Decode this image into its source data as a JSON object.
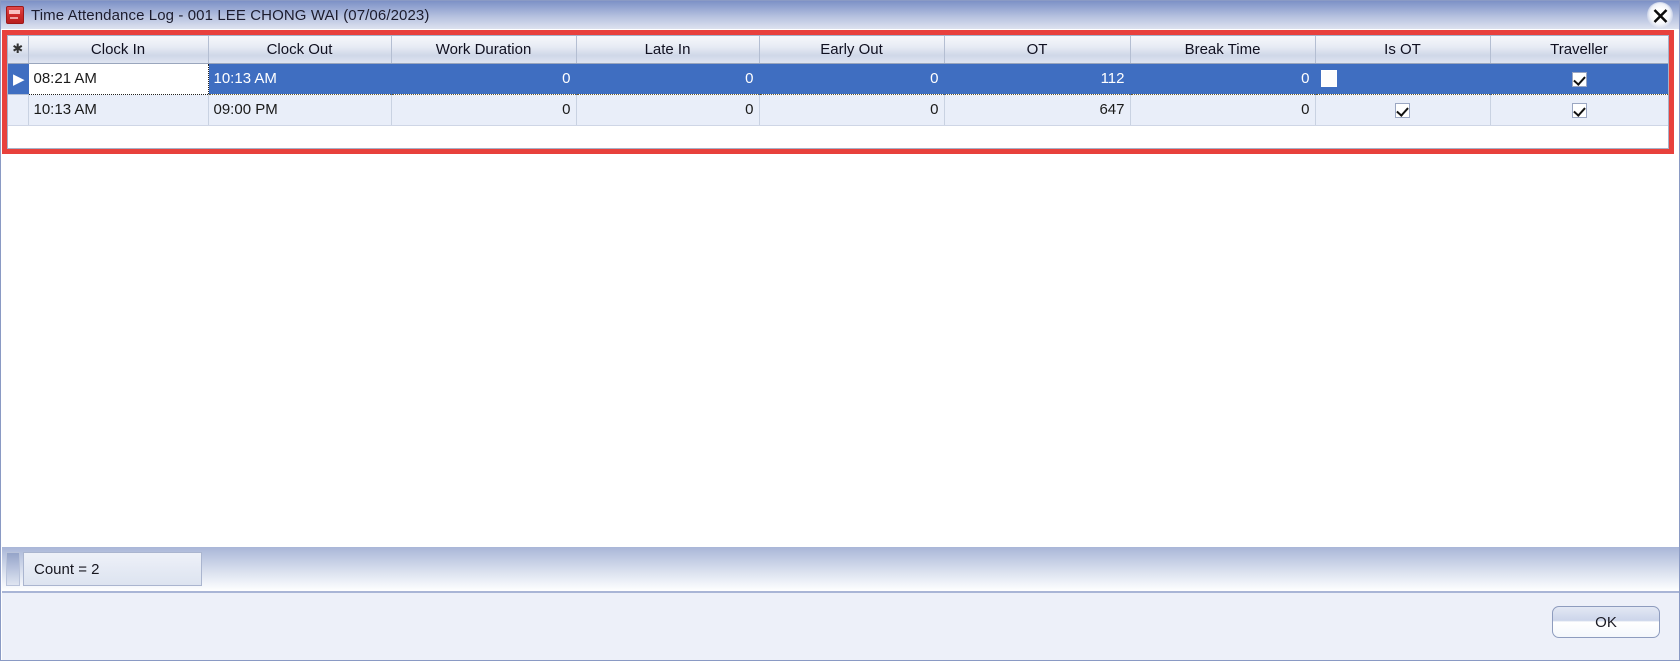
{
  "window": {
    "title": "Time Attendance Log - 001 LEE CHONG WAI (07/06/2023)",
    "icon": "app-logo-icon",
    "close_label": "✕"
  },
  "colors": {
    "title_bar_top": "#7d91c6",
    "title_bar_bottom": "#dde2ef",
    "selection_blue": "#3f6ec1",
    "annotation_red": "#e8413c",
    "row_alt": "#e9eef9"
  },
  "grid": {
    "row_indicator_header": "✱",
    "current_row_marker": "▶",
    "columns": [
      {
        "key": "clock_in",
        "label": "Clock In",
        "align": "left"
      },
      {
        "key": "clock_out",
        "label": "Clock Out",
        "align": "left"
      },
      {
        "key": "work_duration",
        "label": "Work Duration",
        "align": "right"
      },
      {
        "key": "late_in",
        "label": "Late In",
        "align": "right"
      },
      {
        "key": "early_out",
        "label": "Early Out",
        "align": "right"
      },
      {
        "key": "ot",
        "label": "OT",
        "align": "right"
      },
      {
        "key": "break_time",
        "label": "Break Time",
        "align": "right"
      },
      {
        "key": "is_ot",
        "label": "Is OT",
        "align": "center"
      },
      {
        "key": "traveller",
        "label": "Traveller",
        "align": "center"
      }
    ],
    "rows": [
      {
        "selected": true,
        "clock_in": "08:21 AM",
        "clock_out": "10:13 AM",
        "work_duration": "0",
        "late_in": "0",
        "early_out": "0",
        "ot": "112",
        "break_time": "0",
        "is_ot": false,
        "traveller": true
      },
      {
        "selected": false,
        "clock_in": "10:13 AM",
        "clock_out": "09:00 PM",
        "work_duration": "0",
        "late_in": "0",
        "early_out": "0",
        "ot": "647",
        "break_time": "0",
        "is_ot": true,
        "traveller": true
      }
    ]
  },
  "statusbar": {
    "count_label": "Count = 2"
  },
  "footer": {
    "ok_label": "OK"
  }
}
